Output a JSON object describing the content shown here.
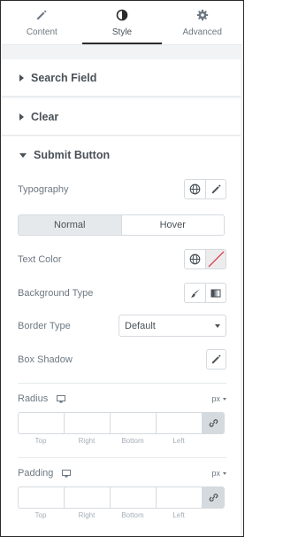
{
  "tabs": [
    {
      "label": "Content",
      "icon": "pencil-icon",
      "active": false
    },
    {
      "label": "Style",
      "icon": "half-circle-icon",
      "active": true
    },
    {
      "label": "Advanced",
      "icon": "gear-icon",
      "active": false
    }
  ],
  "sections": {
    "search_field": "Search Field",
    "clear": "Clear",
    "submit_button": "Submit Button"
  },
  "submit_button": {
    "typography_label": "Typography",
    "state_tabs": {
      "normal": "Normal",
      "hover": "Hover",
      "active": "Normal"
    },
    "text_color_label": "Text Color",
    "background_type_label": "Background Type",
    "border_type_label": "Border Type",
    "border_type_value": "Default",
    "box_shadow_label": "Box Shadow",
    "radius": {
      "label": "Radius",
      "unit": "px",
      "fields": {
        "top": "Top",
        "right": "Right",
        "bottom": "Bottom",
        "left": "Left"
      }
    },
    "padding": {
      "label": "Padding",
      "unit": "px",
      "fields": {
        "top": "Top",
        "right": "Right",
        "bottom": "Bottom",
        "left": "Left"
      }
    }
  },
  "colors": {
    "text": "#495157",
    "muted": "#6d7882",
    "border": "#d5dadf",
    "panel_bg": "#f1f3f5",
    "unset_color_slash": "#d72b3f"
  }
}
